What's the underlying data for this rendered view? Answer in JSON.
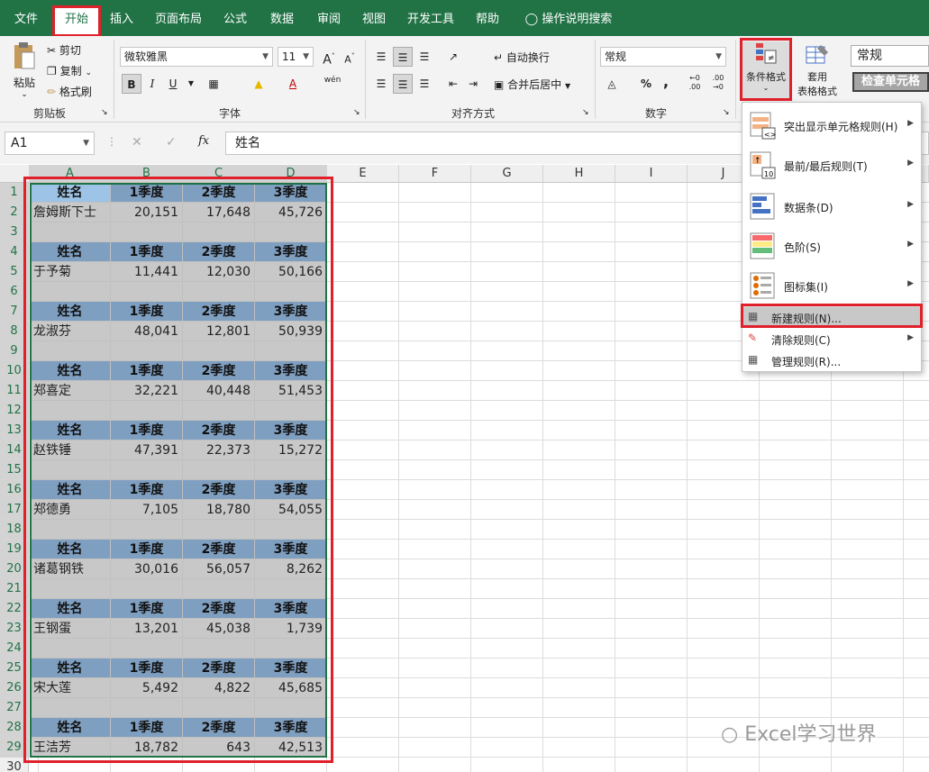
{
  "tabs": [
    "文件",
    "开始",
    "插入",
    "页面布局",
    "公式",
    "数据",
    "审阅",
    "视图",
    "开发工具",
    "帮助"
  ],
  "tell_me": "操作说明搜索",
  "clipboard": {
    "paste": "粘贴",
    "cut": "剪切",
    "copy": "复制",
    "format_painter": "格式刷",
    "group": "剪贴板"
  },
  "font": {
    "name": "微软雅黑",
    "size": "11",
    "bold": "B",
    "italic": "I",
    "underline": "U",
    "grow": "A",
    "shrink": "A",
    "phonetic": "wén",
    "group": "字体"
  },
  "align": {
    "wrap": "自动换行",
    "merge": "合并后居中",
    "group": "对齐方式"
  },
  "number": {
    "format": "常规",
    "percent": "%",
    "comma": ",",
    "group": "数字"
  },
  "styles": {
    "conditional": "条件格式",
    "table_top": "套用",
    "table_bottom": "表格格式",
    "normal_style": "常规",
    "check_cell": "检查单元格"
  },
  "namebox": "A1",
  "formula": "姓名",
  "columns": [
    "A",
    "B",
    "C",
    "D",
    "E",
    "F",
    "G",
    "H",
    "I",
    "J"
  ],
  "rows": [
    "1",
    "2",
    "3",
    "4",
    "5",
    "6",
    "7",
    "8",
    "9",
    "10",
    "11",
    "12",
    "13",
    "14",
    "15",
    "16",
    "17",
    "18",
    "19",
    "20",
    "21",
    "22",
    "23",
    "24",
    "25",
    "26",
    "27",
    "28",
    "29",
    "30"
  ],
  "headers": [
    "姓名",
    "1季度",
    "2季度",
    "3季度"
  ],
  "records": [
    [
      "詹姆斯下士",
      "20,151",
      "17,648",
      "45,726"
    ],
    [
      "于予菊",
      "11,441",
      "12,030",
      "50,166"
    ],
    [
      "龙淑芬",
      "48,041",
      "12,801",
      "50,939"
    ],
    [
      "郑喜定",
      "32,221",
      "40,448",
      "51,453"
    ],
    [
      "赵铁锤",
      "47,391",
      "22,373",
      "15,272"
    ],
    [
      "郑德勇",
      "7,105",
      "18,780",
      "54,055"
    ],
    [
      "诸葛钢铁",
      "30,016",
      "56,057",
      "8,262"
    ],
    [
      "王钢蛋",
      "13,201",
      "45,038",
      "1,739"
    ],
    [
      "宋大莲",
      "5,492",
      "4,822",
      "45,685"
    ],
    [
      "王洁芳",
      "18,782",
      "643",
      "42,513"
    ]
  ],
  "menu": {
    "highlight": "突出显示单元格规则(H)",
    "topbottom": "最前/最后规则(T)",
    "databar": "数据条(D)",
    "colorscale": "色阶(S)",
    "iconset": "图标集(I)",
    "newrule": "新建规则(N)...",
    "clearrule": "清除规则(C)",
    "managerule": "管理规则(R)..."
  },
  "watermark": "Excel学习世界"
}
